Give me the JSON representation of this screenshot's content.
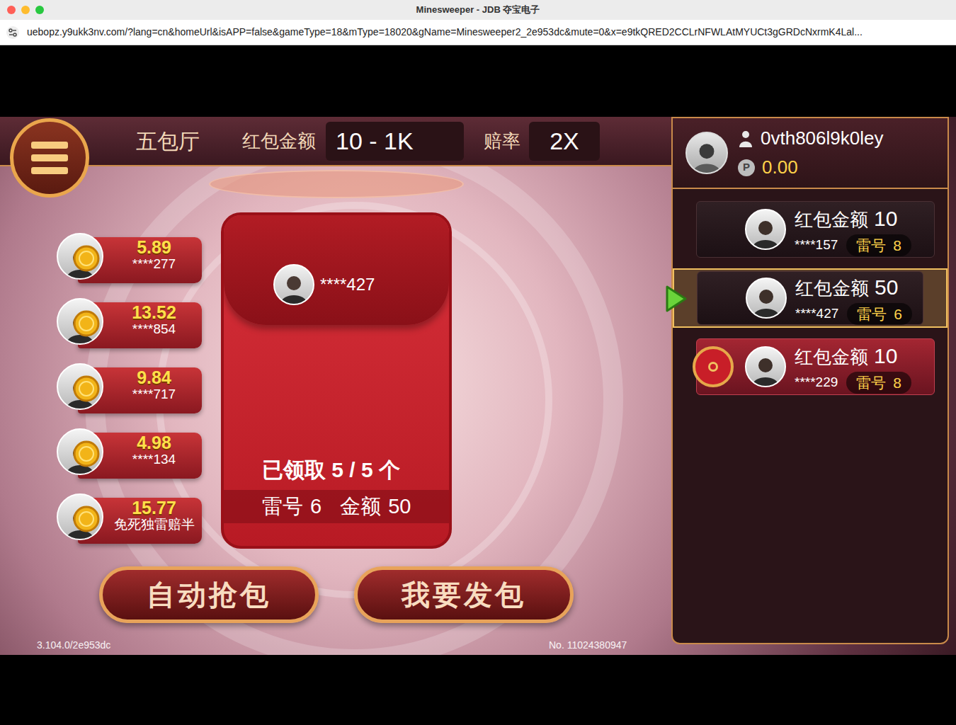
{
  "window": {
    "title": "Minesweeper - JDB 夺宝电子"
  },
  "browser": {
    "url": "uebopz.y9ukk3nv.com/?lang=cn&homeUrl&isAPP=false&gameType=18&mType=18020&gName=Minesweeper2_2e953dc&mute=0&x=e9tkQRED2CCLrNFWLAtMYUCt3gGRDcNxrmK4Lal..."
  },
  "top_bar": {
    "room": "五包厅",
    "amount_label": "红包金额",
    "amount_range": "10 - 1K",
    "odds_label": "赔率",
    "odds": "2X"
  },
  "player": {
    "name": "0vth806l9k0ley",
    "points_badge": "P",
    "balance": "0.00"
  },
  "grabbers": [
    {
      "amount": "5.89",
      "name": "****277"
    },
    {
      "amount": "13.52",
      "name": "****854"
    },
    {
      "amount": "9.84",
      "name": "****717"
    },
    {
      "amount": "4.98",
      "name": "****134"
    },
    {
      "amount": "15.77",
      "name": "免死独雷赔半"
    }
  ],
  "packet": {
    "user": "****427",
    "claimed": "已领取 5 / 5 个",
    "mine_label": "雷号",
    "mine": "6",
    "amount_label": "金额",
    "amount": "50"
  },
  "packets": [
    {
      "amount_label": "红包金额",
      "amount": "10",
      "user": "****157",
      "mine_label": "雷号",
      "mine": "8",
      "selected": false,
      "has_badge": false
    },
    {
      "amount_label": "红包金额",
      "amount": "50",
      "user": "****427",
      "mine_label": "雷号",
      "mine": "6",
      "selected": true,
      "has_badge": false
    },
    {
      "amount_label": "红包金额",
      "amount": "10",
      "user": "****229",
      "mine_label": "雷号",
      "mine": "8",
      "selected": false,
      "has_badge": true
    }
  ],
  "buttons": [
    "自动抢包",
    "我要发包"
  ],
  "footer": {
    "version": "3.104.0/2e953dc",
    "round_no": "No. 11024380947"
  }
}
